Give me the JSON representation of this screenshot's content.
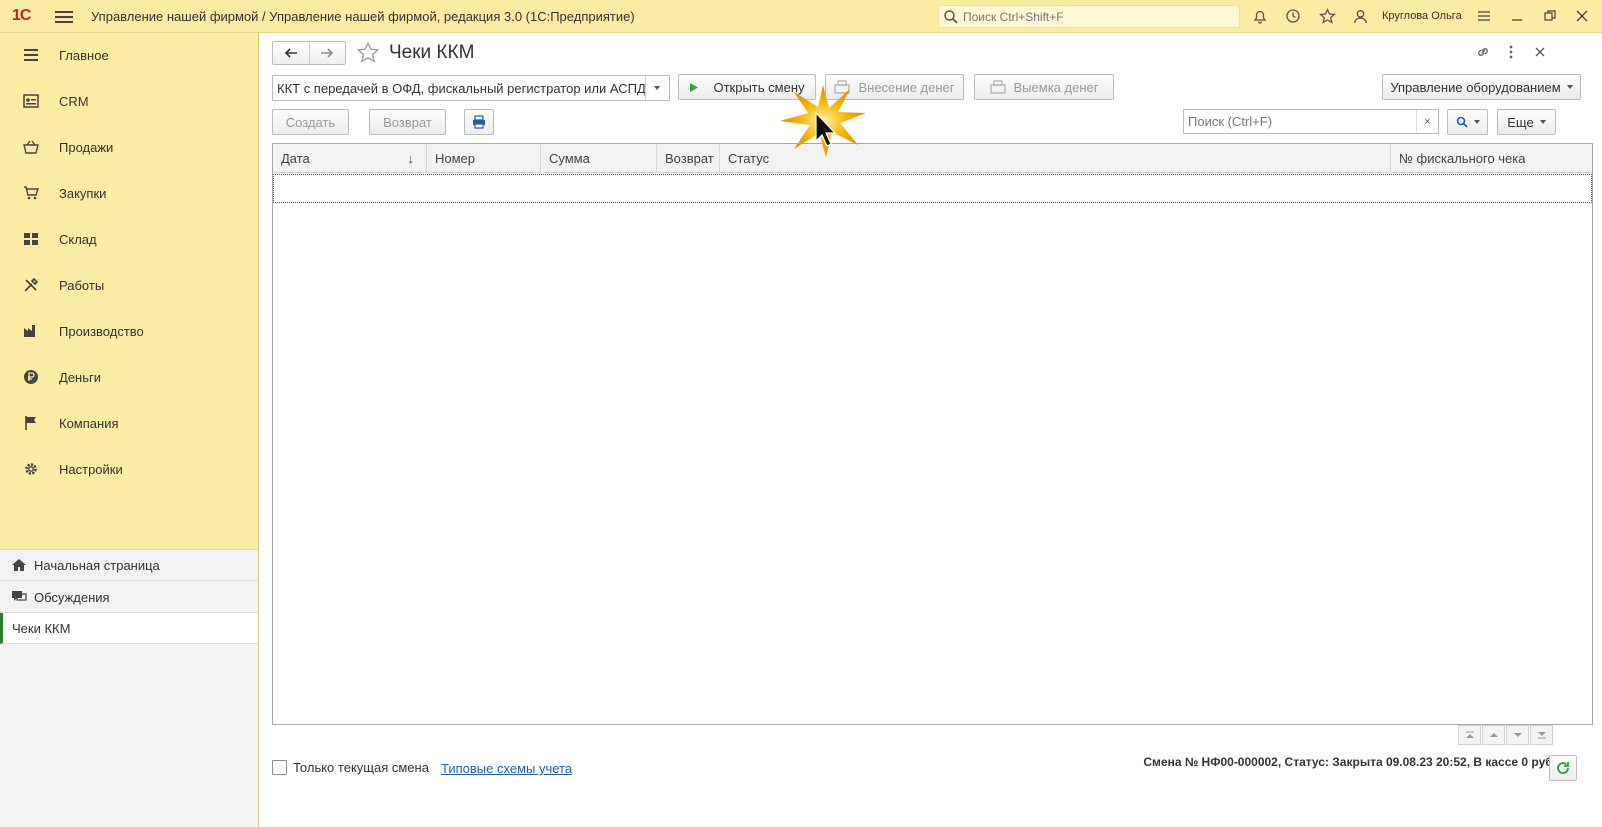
{
  "titlebar": {
    "logo": "1С",
    "app_title": "Управление нашей фирмой / Управление нашей фирмой, редакция 3.0  (1С:Предприятие)",
    "search_placeholder": "Поиск Ctrl+Shift+F",
    "user": "Круглова Ольга",
    "icons": [
      "bell-icon",
      "history-icon",
      "star-icon",
      "user-icon",
      "settings-icon",
      "minimize-icon",
      "restore-icon",
      "close-icon"
    ]
  },
  "sidebar": {
    "items": [
      {
        "label": "Главное",
        "icon": "menu-icon"
      },
      {
        "label": "CRM",
        "icon": "crm-icon"
      },
      {
        "label": "Продажи",
        "icon": "basket-icon"
      },
      {
        "label": "Закупки",
        "icon": "cart-icon"
      },
      {
        "label": "Склад",
        "icon": "warehouse-icon"
      },
      {
        "label": "Работы",
        "icon": "tools-icon"
      },
      {
        "label": "Производство",
        "icon": "factory-icon"
      },
      {
        "label": "Деньги",
        "icon": "ruble-icon"
      },
      {
        "label": "Компания",
        "icon": "flag-icon"
      },
      {
        "label": "Настройки",
        "icon": "gear-icon"
      }
    ],
    "bottom": {
      "home": "Начальная страница",
      "discussions": "Обсуждения",
      "open_form": "Чеки ККМ"
    }
  },
  "form": {
    "title": "Чеки ККМ",
    "kkt_select": "ККТ с передачей в ОФД, фискальный регистратор или АСПД,",
    "buttons": {
      "open_shift": "Открыть смену",
      "deposit": "Внесение денег",
      "withdraw": "Выемка денег",
      "equipment": "Управление оборудованием",
      "create": "Создать",
      "return": "Возврат",
      "more": "Еще"
    },
    "search_placeholder": "Поиск (Ctrl+F)",
    "clear": "×",
    "columns": [
      "Дата",
      "Номер",
      "Сумма",
      "Возврат",
      "Статус",
      "№ фискального чека"
    ],
    "sort_indicator": "↓",
    "rows": [],
    "only_current_shift": "Только текущая смена",
    "link": "Типовые схемы учета",
    "status": "Смена № НФ00-000002, Статус: Закрыта 09.08.23 20:52, В кассе 0 руб."
  },
  "colors": {
    "panel": "#fbeca4",
    "accent_green": "#2e7d32",
    "link": "#1f5fa8"
  }
}
